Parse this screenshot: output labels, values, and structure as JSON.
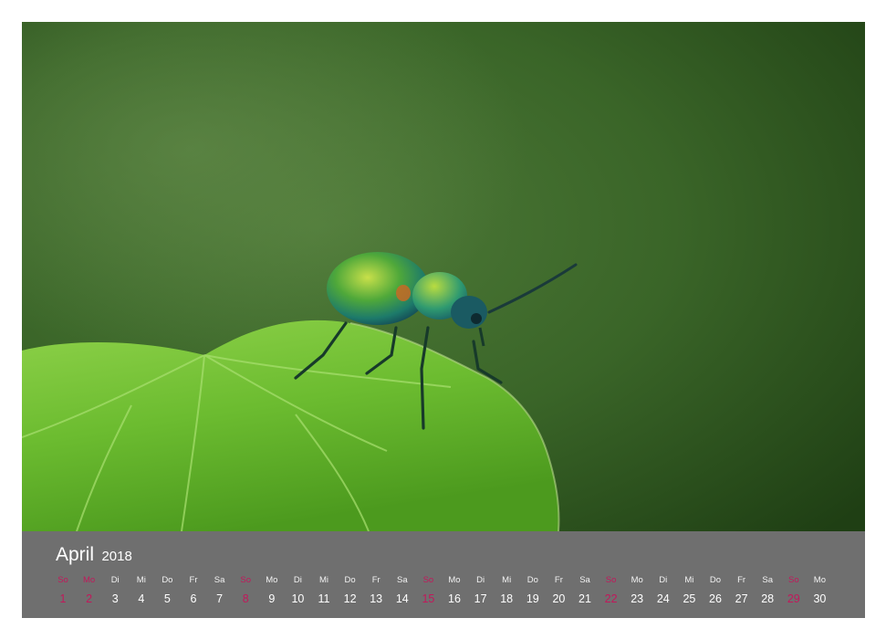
{
  "calendar": {
    "month": "April",
    "year": "2018",
    "days": [
      {
        "abbr": "So",
        "num": "1",
        "red": true
      },
      {
        "abbr": "Mo",
        "num": "2",
        "red": true
      },
      {
        "abbr": "Di",
        "num": "3",
        "red": false
      },
      {
        "abbr": "Mi",
        "num": "4",
        "red": false
      },
      {
        "abbr": "Do",
        "num": "5",
        "red": false
      },
      {
        "abbr": "Fr",
        "num": "6",
        "red": false
      },
      {
        "abbr": "Sa",
        "num": "7",
        "red": false
      },
      {
        "abbr": "So",
        "num": "8",
        "red": true
      },
      {
        "abbr": "Mo",
        "num": "9",
        "red": false
      },
      {
        "abbr": "Di",
        "num": "10",
        "red": false
      },
      {
        "abbr": "Mi",
        "num": "11",
        "red": false
      },
      {
        "abbr": "Do",
        "num": "12",
        "red": false
      },
      {
        "abbr": "Fr",
        "num": "13",
        "red": false
      },
      {
        "abbr": "Sa",
        "num": "14",
        "red": false
      },
      {
        "abbr": "So",
        "num": "15",
        "red": true
      },
      {
        "abbr": "Mo",
        "num": "16",
        "red": false
      },
      {
        "abbr": "Di",
        "num": "17",
        "red": false
      },
      {
        "abbr": "Mi",
        "num": "18",
        "red": false
      },
      {
        "abbr": "Do",
        "num": "19",
        "red": false
      },
      {
        "abbr": "Fr",
        "num": "20",
        "red": false
      },
      {
        "abbr": "Sa",
        "num": "21",
        "red": false
      },
      {
        "abbr": "So",
        "num": "22",
        "red": true
      },
      {
        "abbr": "Mo",
        "num": "23",
        "red": false
      },
      {
        "abbr": "Di",
        "num": "24",
        "red": false
      },
      {
        "abbr": "Mi",
        "num": "25",
        "red": false
      },
      {
        "abbr": "Do",
        "num": "26",
        "red": false
      },
      {
        "abbr": "Fr",
        "num": "27",
        "red": false
      },
      {
        "abbr": "Sa",
        "num": "28",
        "red": false
      },
      {
        "abbr": "So",
        "num": "29",
        "red": true
      },
      {
        "abbr": "Mo",
        "num": "30",
        "red": false
      }
    ]
  },
  "colors": {
    "strip_background": "#6f6f6f",
    "highlight_day": "#c2185b",
    "background_green": "#2e5a1e",
    "leaf_green": "#6fbf3a"
  }
}
